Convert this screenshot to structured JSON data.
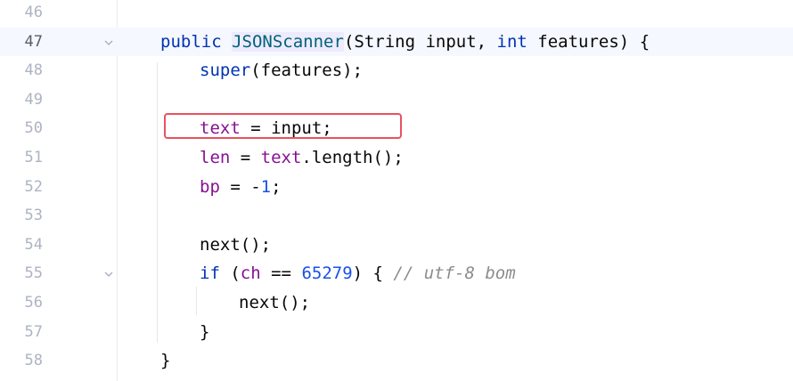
{
  "editor": {
    "lines": [
      {
        "number": "46"
      },
      {
        "number": "47",
        "current": true,
        "foldable": true,
        "t_public": "public",
        "t_name": "JSONScanner",
        "t_open": "(String input, ",
        "t_int": "int",
        "t_close": " features) {"
      },
      {
        "number": "48",
        "t_super": "super",
        "t_rest": "(features);"
      },
      {
        "number": "49"
      },
      {
        "number": "50",
        "t_text": "text",
        "t_rest": " = input;"
      },
      {
        "number": "51",
        "t_len": "len",
        "t_mid": " = ",
        "t_text": "text",
        "t_rest": ".length();"
      },
      {
        "number": "52",
        "t_bp": "bp",
        "t_mid": " = -",
        "t_num": "1",
        "t_rest": ";"
      },
      {
        "number": "53"
      },
      {
        "number": "54",
        "t_rest": "next();"
      },
      {
        "number": "55",
        "foldable": true,
        "t_if": "if",
        "t_open": " (",
        "t_ch": "ch",
        "t_eq": " == ",
        "t_num": "65279",
        "t_close": ") { ",
        "t_comment": "// utf-8 bom"
      },
      {
        "number": "56",
        "t_rest": "next();"
      },
      {
        "number": "57",
        "t_rest": "}"
      },
      {
        "number": "58",
        "t_rest": "}"
      }
    ],
    "annotation": {
      "label": "highlighted-assignment",
      "color": "#e8525f"
    },
    "colors": {
      "keyword": "#0033b3",
      "field": "#871094",
      "number": "#1750eb",
      "comment": "#8c8c8c",
      "declaration": "#00627a",
      "current_line": "#f5f8fe"
    },
    "icons": {
      "fold": "chevron-down-icon"
    }
  }
}
